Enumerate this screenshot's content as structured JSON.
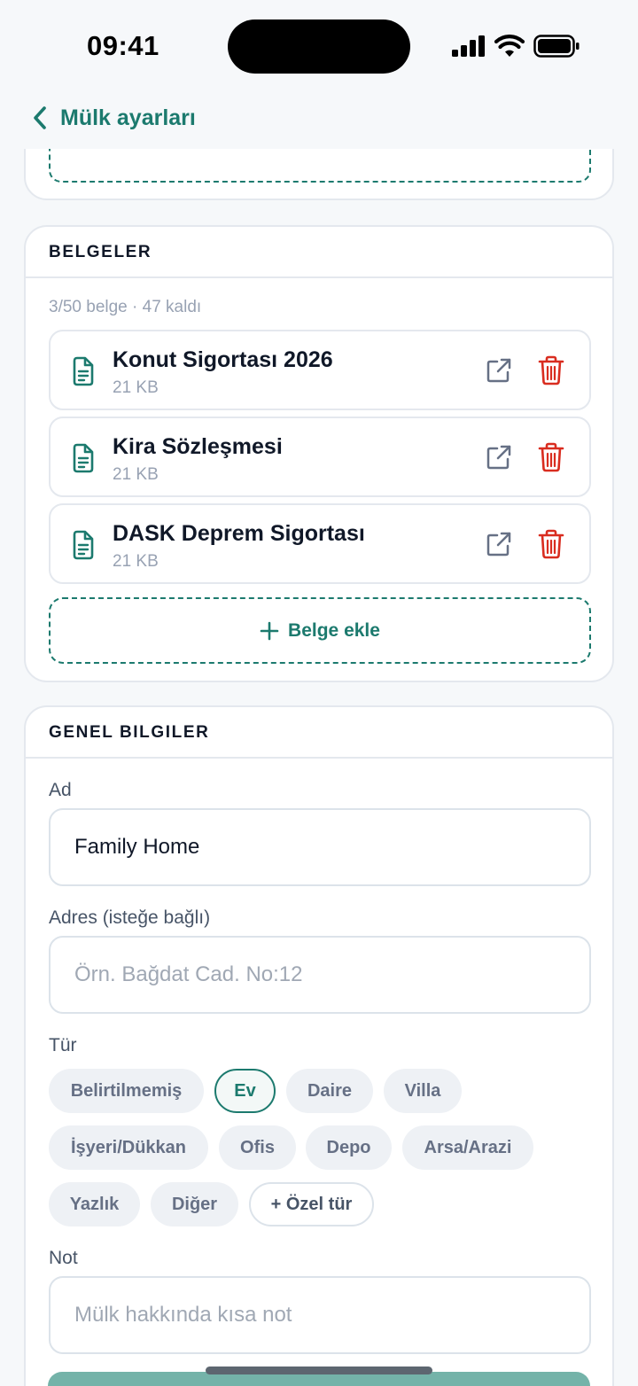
{
  "status_bar": {
    "time": "09:41"
  },
  "nav": {
    "back_label": "Mülk ayarları"
  },
  "documents": {
    "title": "BELGELER",
    "count_text": "3/50 belge · 47 kaldı",
    "items": [
      {
        "name": "Konut Sigortası 2026",
        "size": "21 KB"
      },
      {
        "name": "Kira Sözleşmesi",
        "size": "21 KB"
      },
      {
        "name": "DASK Deprem Sigortası",
        "size": "21 KB"
      }
    ],
    "add_label": "Belge ekle"
  },
  "general": {
    "title": "GENEL BILGILER",
    "name_label": "Ad",
    "name_value": "Family Home",
    "address_label": "Adres (isteğe bağlı)",
    "address_placeholder": "Örn. Bağdat Cad. No:12",
    "type_label": "Tür",
    "types": [
      "Belirtilmemiş",
      "Ev",
      "Daire",
      "Villa",
      "İşyeri/Dükkan",
      "Ofis",
      "Depo",
      "Arsa/Arazi",
      "Yazlık",
      "Diğer"
    ],
    "selected_type": "Ev",
    "custom_type_label": "+ Özel tür",
    "note_label": "Not",
    "note_placeholder": "Mülk hakkında kısa not"
  },
  "colors": {
    "accent": "#1C7A6E",
    "danger": "#D92D20",
    "background": "#F6F8FA",
    "submit_button": "#74B3A9"
  }
}
